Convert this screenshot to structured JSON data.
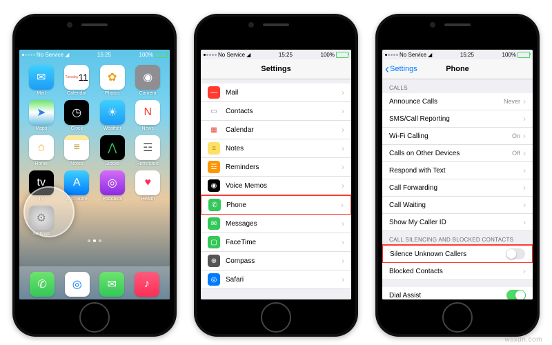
{
  "statusbar": {
    "carrier": "No Service",
    "wifi": "▾",
    "time": "15:25",
    "battery_pct": "100%"
  },
  "home": {
    "apps": [
      {
        "label": "Mail",
        "color": "linear-gradient(#3ed0fe,#1e9cf7)",
        "glyph": "✉"
      },
      {
        "label": "Calendar",
        "color": "#fff",
        "glyph": "11",
        "text": "#e74c3c",
        "sub": "Tuesday"
      },
      {
        "label": "Photos",
        "color": "#fff",
        "glyph": "✿",
        "text": "#f39c12"
      },
      {
        "label": "Camera",
        "color": "#8e8e93",
        "glyph": "◉"
      },
      {
        "label": "Maps",
        "color": "linear-gradient(#6ee36e,#fff 50%,#6ec1e3)",
        "glyph": "➤",
        "text": "#3478f6"
      },
      {
        "label": "Clock",
        "color": "#000",
        "glyph": "◷"
      },
      {
        "label": "Weather",
        "color": "linear-gradient(#3ed0fe,#1e9cf7)",
        "glyph": "☀"
      },
      {
        "label": "News",
        "color": "#fff",
        "glyph": "N",
        "text": "#ff3b30"
      },
      {
        "label": "Home",
        "color": "#fff",
        "glyph": "⌂",
        "text": "#ff9500"
      },
      {
        "label": "Notes",
        "color": "linear-gradient(#ffe9a0 20%,#fff 20%)",
        "glyph": "≡",
        "text": "#c7a84a"
      },
      {
        "label": "Stocks",
        "color": "#000",
        "glyph": "⋀",
        "text": "#34c759"
      },
      {
        "label": "Reminders",
        "color": "#fff",
        "glyph": "☲",
        "text": "#555"
      },
      {
        "label": "TV",
        "color": "#000",
        "glyph": "tv",
        "text": "#fff"
      },
      {
        "label": "App Store",
        "color": "linear-gradient(#3ed0fe,#007aff)",
        "glyph": "A"
      },
      {
        "label": "Podcasts",
        "color": "linear-gradient(#d56cf7,#8a2be2)",
        "glyph": "◎"
      },
      {
        "label": "Health",
        "color": "#fff",
        "glyph": "♥",
        "text": "#ff2d55"
      },
      {
        "label": "Settings",
        "color": "radial-gradient(#e0e0e0,#8e8e93)",
        "glyph": "⚙",
        "text": "#555"
      }
    ],
    "dock": [
      {
        "name": "phone",
        "color": "linear-gradient(#6ee36e,#34c759)",
        "glyph": "✆"
      },
      {
        "name": "safari",
        "color": "#fff",
        "glyph": "◎",
        "text": "#007aff"
      },
      {
        "name": "messages",
        "color": "linear-gradient(#6ee36e,#34c759)",
        "glyph": "✉"
      },
      {
        "name": "music",
        "color": "linear-gradient(#fc5c7d,#ff2d55)",
        "glyph": "♪"
      }
    ]
  },
  "settings": {
    "title": "Settings",
    "rows": [
      {
        "icon": "#ff3b30",
        "glyph": "—",
        "label": "Mail"
      },
      {
        "icon": "#fff",
        "glyph": "▭",
        "label": "Contacts",
        "text": "#888"
      },
      {
        "icon": "#fff",
        "glyph": "▦",
        "label": "Calendar",
        "text": "#e74c3c"
      },
      {
        "icon": "#ffe066",
        "glyph": "≡",
        "label": "Notes",
        "text": "#b58900"
      },
      {
        "icon": "#ff9500",
        "glyph": "☲",
        "label": "Reminders"
      },
      {
        "icon": "#000",
        "glyph": "◉",
        "label": "Voice Memos"
      },
      {
        "icon": "#34c759",
        "glyph": "✆",
        "label": "Phone",
        "highlight": true
      },
      {
        "icon": "#34c759",
        "glyph": "✉",
        "label": "Messages"
      },
      {
        "icon": "#34c759",
        "glyph": "▢",
        "label": "FaceTime"
      },
      {
        "icon": "#555",
        "glyph": "⊕",
        "label": "Compass"
      },
      {
        "icon": "#007aff",
        "glyph": "◎",
        "label": "Safari"
      }
    ]
  },
  "phone_settings": {
    "back": "Settings",
    "title": "Phone",
    "sections": [
      {
        "header": "CALLS",
        "rows": [
          {
            "label": "Announce Calls",
            "value": "Never",
            "type": "link"
          },
          {
            "label": "SMS/Call Reporting",
            "type": "link"
          },
          {
            "label": "Wi-Fi Calling",
            "value": "On",
            "type": "link"
          },
          {
            "label": "Calls on Other Devices",
            "value": "Off",
            "type": "link"
          },
          {
            "label": "Respond with Text",
            "type": "link"
          },
          {
            "label": "Call Forwarding",
            "type": "link"
          },
          {
            "label": "Call Waiting",
            "type": "link"
          },
          {
            "label": "Show My Caller ID",
            "type": "link"
          }
        ]
      },
      {
        "header": "CALL SILENCING AND BLOCKED CONTACTS",
        "rows": [
          {
            "label": "Silence Unknown Callers",
            "type": "toggle",
            "on": false,
            "highlight": true
          },
          {
            "label": "Blocked Contacts",
            "type": "link"
          }
        ]
      },
      {
        "header": "",
        "rows": [
          {
            "label": "Dial Assist",
            "type": "toggle",
            "on": true
          }
        ]
      }
    ]
  },
  "watermark": "wsxdn.com"
}
